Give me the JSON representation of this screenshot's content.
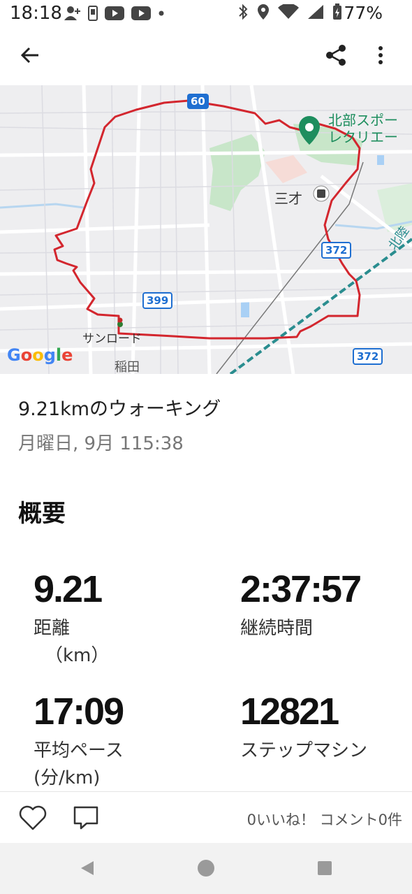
{
  "status_bar": {
    "time": "18:18",
    "battery": "77%"
  },
  "app_bar": {
    "back_icon": "arrow-back-icon",
    "share_icon": "share-icon",
    "more_icon": "more-vert-icon"
  },
  "map": {
    "labels": {
      "route60": "60",
      "route399": "399",
      "route372a": "372",
      "route372b": "372",
      "park": "北部スポー",
      "park2": "レクリエー",
      "station": "三才",
      "road": "サンロード",
      "area": "稲田",
      "rail": "北陸",
      "google": "Google"
    },
    "route_color": "#d3262e"
  },
  "activity": {
    "title": "9.21kmのウォーキング",
    "date": "月曜日, 9月 115:38"
  },
  "summary": {
    "heading": "概要",
    "stats": [
      {
        "value": "9.21",
        "label": "距離",
        "unit": "（km）"
      },
      {
        "value": "2:37:57",
        "label": "継続時間",
        "unit": ""
      },
      {
        "value": "17:09",
        "label": "平均ペース",
        "unit": "(分/km)"
      },
      {
        "value": "12821",
        "label": "ステップマシン",
        "unit": ""
      }
    ]
  },
  "social": {
    "text": "0いいね！ コメント0件"
  }
}
